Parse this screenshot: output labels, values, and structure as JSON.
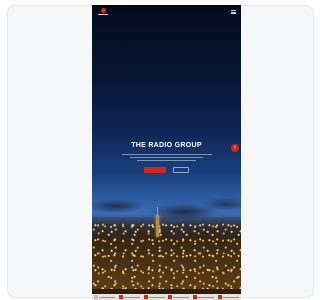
{
  "hero": {
    "title": "THE RADIO GROUP"
  },
  "icons": {
    "menu": "menu-icon",
    "next": "chevron-right-icon",
    "logo": "brand-logo-icon"
  },
  "colors": {
    "accent": "#d8231b",
    "card_background": "#f6f7f9",
    "sky_top": "#040a1c",
    "sky_horizon": "#3d6cb2"
  }
}
